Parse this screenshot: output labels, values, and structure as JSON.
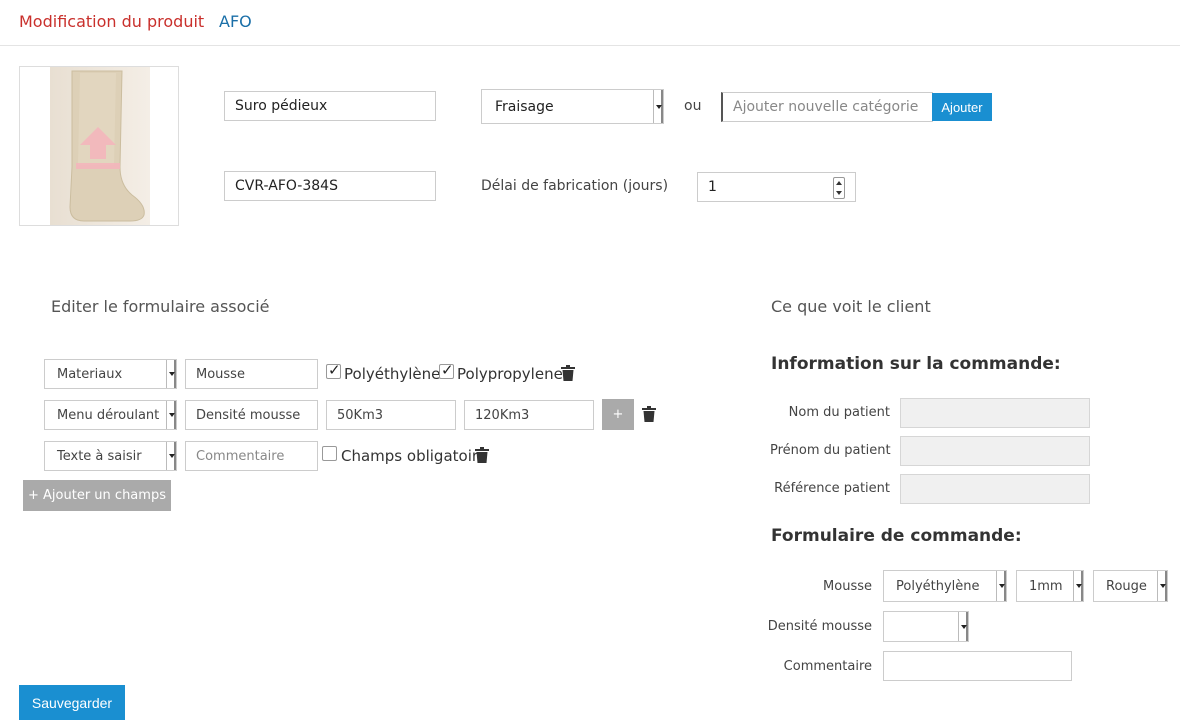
{
  "header": {
    "title": "Modification du produit",
    "tag": "AFO"
  },
  "product": {
    "name": "Suro pédieux",
    "reference": "CVR-AFO-384S",
    "category": "Fraisage",
    "or_label": "ou",
    "new_category_placeholder": "Ajouter nouvelle catégorie",
    "add_button": "Ajouter",
    "delay_label": "Délai de fabrication (jours)",
    "delay_value": "1"
  },
  "editor": {
    "title": "Editer le formulaire associé",
    "rows": [
      {
        "type": "Materiaux",
        "name": "Mousse",
        "options": [
          {
            "label": "Polyéthylène",
            "checked": true
          },
          {
            "label": "Polypropylene",
            "checked": true
          }
        ]
      },
      {
        "type": "Menu déroulant",
        "name": "Densité mousse",
        "values": [
          "50Km3",
          "120Km3"
        ],
        "plus_label": "+"
      },
      {
        "type": "Texte à saisir",
        "name": "Commentaire",
        "required_label": "Champs obligatoire",
        "required_checked": false
      }
    ],
    "add_field_button": "+ Ajouter un champs"
  },
  "preview": {
    "title": "Ce que voit le client",
    "info_heading": "Information sur la commande:",
    "info_fields": [
      "Nom du patient",
      "Prénom du patient",
      "Référence patient"
    ],
    "order_heading": "Formulaire de commande:",
    "mousse_label": "Mousse",
    "mousse_selects": [
      "Polyéthylène",
      "1mm",
      "Rouge"
    ],
    "densite_label": "Densité mousse",
    "densite_value": "",
    "commentaire_label": "Commentaire"
  },
  "save_button": "Sauvegarder",
  "colors": {
    "accent_red": "#c9302c",
    "link_blue": "#1a6fa8",
    "button_blue": "#1a8fd1"
  },
  "icons": {
    "trash": "trash-icon",
    "upload": "upload-arrow-icon"
  }
}
